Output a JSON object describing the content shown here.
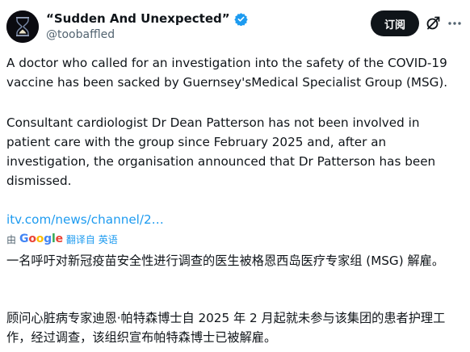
{
  "author": {
    "display_name": "“Sudden And Unexpected”",
    "handle": "@toobaffled",
    "verified": true,
    "avatar_icon": "hourglass-avatar"
  },
  "header_actions": {
    "subscribe_label": "订阅",
    "grok_icon": "grok-icon",
    "more_icon": "more-icon"
  },
  "post": {
    "paragraph_1": "A doctor who called for an investigation into the safety of the COVID-19 vaccine has been sacked by Guernsey'sMedical Specialist Group (MSG).",
    "paragraph_2": "Consultant cardiologist Dr Dean Patterson has not been involved in patient care with the group since February 2025 and, after an investigation, the organisation announced that Dr Patterson has been dismissed.",
    "link": "itv.com/news/channel/2…"
  },
  "translation": {
    "by_label": "由",
    "provider": "Google",
    "action_label": "翻译自 英语",
    "paragraph_1": "一名呼吁对新冠疫苗安全性进行调查的医生被格恩西岛医疗专家组 (MSG) 解雇。",
    "paragraph_2": "顾问心脏病专家迪恩·帕特森博士自 2025 年 2 月起就未参与该集团的患者护理工作，经过调查，该组织宣布帕特森博士已被解雇。"
  },
  "colors": {
    "text": "#0f1419",
    "secondary": "#536471",
    "link": "#1d9bf0",
    "verified": "#1d9bf0",
    "button_bg": "#0f1419"
  }
}
